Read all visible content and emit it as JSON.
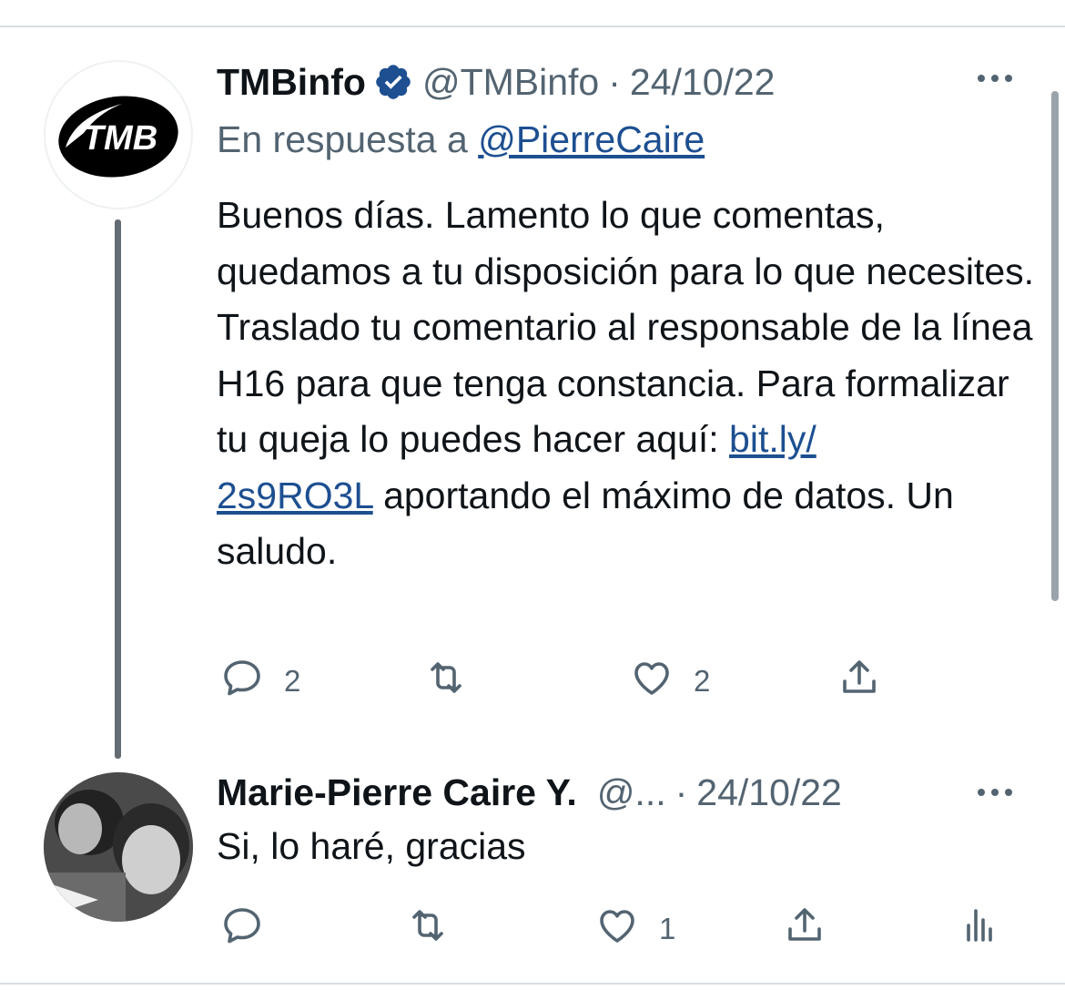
{
  "thread": [
    {
      "author": {
        "name": "TMBinfo",
        "handle": "@TMBinfo",
        "verified": true,
        "avatar_text": "TMB"
      },
      "separator": "·",
      "date": "24/10/22",
      "reply_prefix": "En respuesta a",
      "reply_to": "@PierreCaire",
      "text_before_link": "Buenos días. Lamento lo que comentas, quedamos a tu disposición para lo que necesites. Traslado tu comentario al responsable de la línea H16 para que tenga constancia. Para formalizar tu queja lo puedes hacer aquí: ",
      "link_part1": "bit.ly/",
      "link_part2": "2s9RO3L",
      "text_after_link": " aportando el máximo de datos. Un saludo.",
      "actions": {
        "reply_count": "2",
        "retweet_count": "",
        "like_count": "2"
      }
    },
    {
      "author": {
        "name": "Marie-Pierre Caire Y.",
        "handle": "@...",
        "verified": false
      },
      "separator": "·",
      "date": "24/10/22",
      "text": "Si, lo haré, gracias",
      "actions": {
        "reply_count": "",
        "retweet_count": "",
        "like_count": "1"
      }
    }
  ],
  "icons": {
    "reply": "reply-icon",
    "retweet": "retweet-icon",
    "like": "heart-icon",
    "share": "share-icon",
    "analytics": "analytics-icon",
    "more": "more-icon",
    "verified": "verified-badge-icon"
  },
  "colors": {
    "text": "#0f1419",
    "secondary": "#536471",
    "link": "#1d4f91",
    "verified": "#1d4f91",
    "thread_line": "#646c73"
  }
}
